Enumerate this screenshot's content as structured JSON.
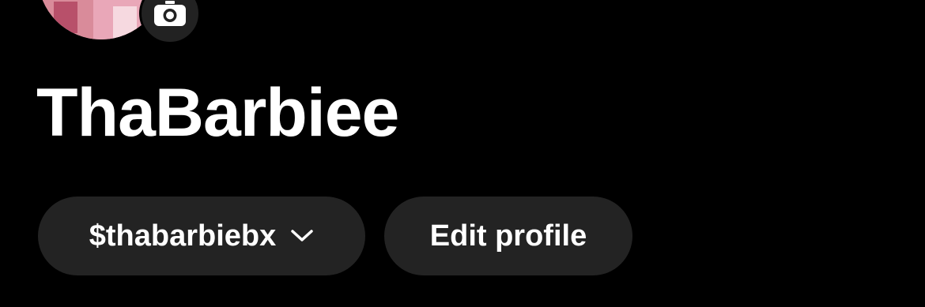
{
  "profile": {
    "display_name": "ThaBarbiee",
    "cashtag": "$thabarbiebx",
    "avatar_icon": "avatar-photo",
    "camera_icon": "camera-icon",
    "dropdown_icon": "chevron-down-icon"
  },
  "actions": {
    "edit_profile_label": "Edit profile"
  },
  "colors": {
    "background": "#000000",
    "pill_background": "#232323",
    "text": "#ffffff",
    "badge_background": "#222222"
  }
}
